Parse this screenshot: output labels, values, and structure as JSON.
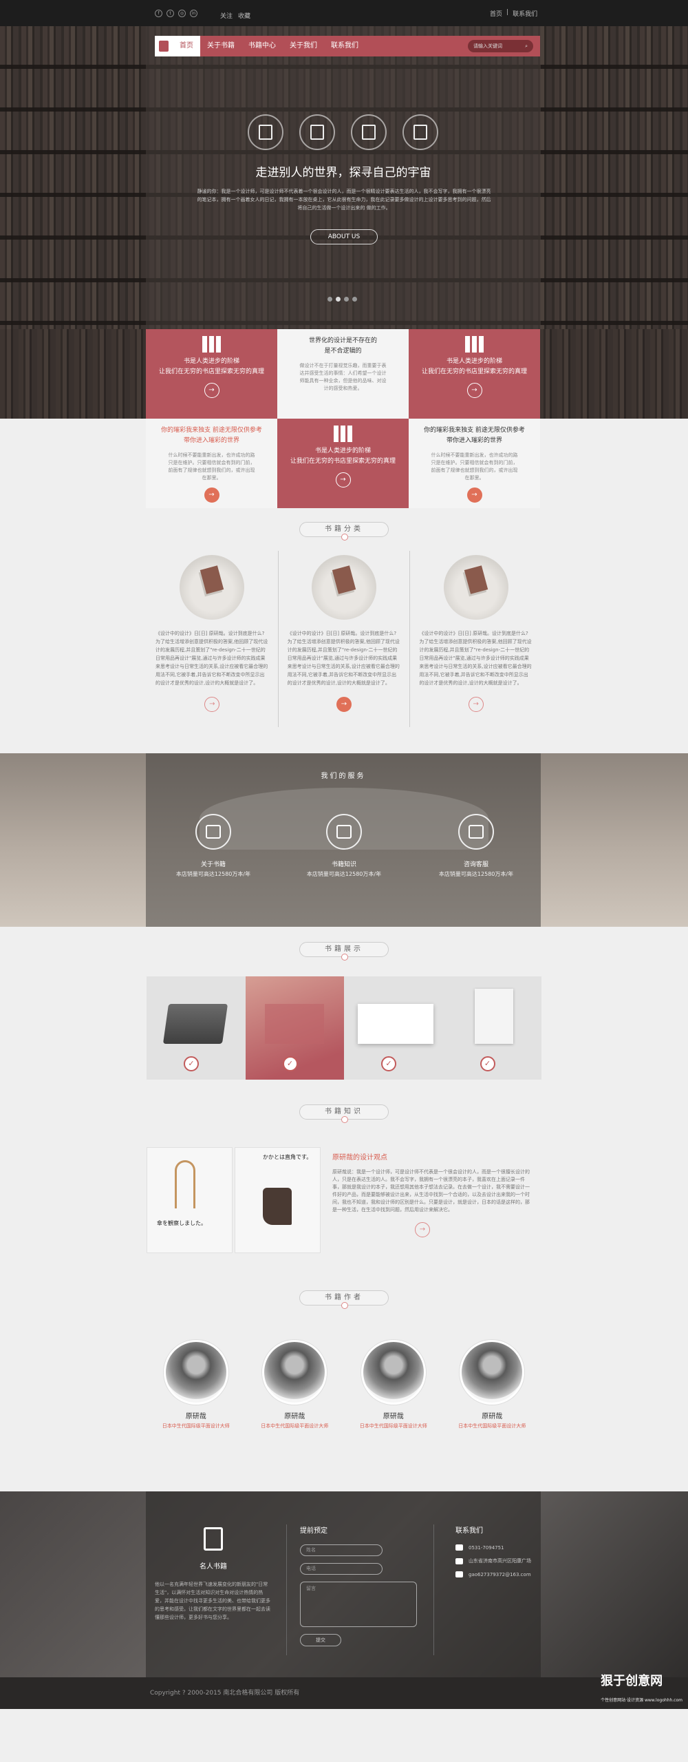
{
  "topbar": {
    "social": [
      "f",
      "t",
      "◎",
      "in"
    ],
    "follow": "关注",
    "favorite": "收藏",
    "home": "首页",
    "separator": "|",
    "contact": "联系我们"
  },
  "nav": {
    "items": [
      "首页",
      "关于书籍",
      "书籍中心",
      "关于我们",
      "联系我们"
    ],
    "search_placeholder": "请输入关键词"
  },
  "hero": {
    "title": "走进别人的世界，探寻自己的宇宙",
    "desc": "静谧的你：我是一个设计师，可是设计师不代表着一个很会设计的人，而是一个很精设计要表达生活的人，我不会写字，我拥有一个很漂亮的笔记本，拥有一个画着女人的日记，我拥有一本放在桌上，它从此很有生命力，我在此记录要多做设计的上设计要多思考到的问题，然后将自己的生活做一个设计出来的 做的工作。",
    "about": "ABOUT US"
  },
  "grid": {
    "c1": {
      "title": "书是人类进步的阶梯",
      "sub": "让我们在无穷的书店里探索无穷的真理"
    },
    "c2": {
      "title": "世界化的设计是不存在的",
      "sub": "是不合逻辑的",
      "text": "做设计不在于打量视觉乐趣，而重要于表达并感受生活的事情：人们希望一个设计师能具有一种业余，但是他的品味、对设计的感受和热爱。"
    },
    "c3": {
      "title": "书是人类进步的阶梯",
      "sub": "让我们在无穷的书店里探索无穷的真理"
    },
    "c4": {
      "title": "你的璀彩我来独支 前途无限仅供参考",
      "sub": "带你进入璀彩的世界",
      "text": "什么时候不要能重新出发，也许成功的路只是在维护。只要相信就会有到的门前，前面有了规律也就想到我们的，或许出现在那里。"
    },
    "c5": {
      "title": "书是人类进步的阶梯",
      "sub": "让我们在无穷的书店里探索无穷的真理"
    },
    "c6": {
      "title": "你的璀彩我来独支 前途无限仅供参考",
      "sub": "带你进入璀彩的世界",
      "text": "什么时候不要能重新出发，也许成功的路只是在维护。只要相信就会有到的门前，前面有了规律也就想到我们的，或许出现在那里。"
    }
  },
  "sections": {
    "categories": "书籍分类",
    "services": "我们的服务",
    "showcase": "书籍展示",
    "knowledge": "书籍知识",
    "authors": "书籍作者"
  },
  "categories": [
    {
      "text": "《设计中的设计》日[日] 原研哉。设计到底是什么?为了给生活增添创意提供积极的答案,他回顾了现代设计的发展历程,并且策划了\"re-design-二十一世纪的日常用品再设计\"展览,通过与许多设计师的实践成果来思考设计与日常生活的关系,设计应被看它最合理的用法不同,它被手着,并告诉它和不断改变中所显示出的设计才是优秀的设计,设计的大概就是设计了。"
    },
    {
      "text": "《设计中的设计》日[日] 原研哉。设计到底是什么?为了给生活增添创意提供积极的答案,他回顾了现代设计的发展历程,并且策划了\"re-design-二十一世纪的日常用品再设计\"展览,通过与许多设计师的实践成果来思考设计与日常生活的关系,设计应被看它最合理的用法不同,它被手着,并告诉它和不断改变中所显示出的设计才是优秀的设计,设计的大概就是设计了。"
    },
    {
      "text": "《设计中的设计》日[日] 原研哉。设计到底是什么?为了给生活增添创意提供积极的答案,他回顾了现代设计的发展历程,并且策划了\"re-design-二十一世纪的日常用品再设计\"展览,通过与许多设计师的实践成果来思考设计与日常生活的关系,设计应被看它最合理的用法不同,它被手着,并告诉它和不断改变中所显示出的设计才是优秀的设计,设计的大概就是设计了。"
    }
  ],
  "services": [
    {
      "title": "关于书籍",
      "sub": "本店销量可高达12580万本/年"
    },
    {
      "title": "书籍知识",
      "sub": "本店销量可高达12580万本/年"
    },
    {
      "title": "咨询客服",
      "sub": "本店销量可高达12580万本/年"
    }
  ],
  "knowledge": {
    "title": "原研哉的设计观点",
    "text": "原研哉说：我是一个设计师，可是设计师不代表是一个很会设计的人，而是一个很擅长设计的人，只是在表达生活的人。我不会写字，我拥有一个很漂亮的本子，我喜欢在上面记录一件事，那就是我设计的本子，我还想用其他本子想法去记录。在去做一个设计，我不需要设计一件好的产品，而是要能够被设计出来，从生活中找到一个合适的，以及去设计出来我的一个时间，我也不知道，我和设计师的区别是什么。只要是设计，就是设计，日本的话是这样的，那是一种生活，在生活中找到问题，然后用设计来解决它。",
    "book2_title": "かかとは直角です。",
    "book1_title": "傘を観察しました。"
  },
  "authors": [
    {
      "name": "原研哉",
      "role": "日本中生代国际级平面设计大师"
    },
    {
      "name": "原研哉",
      "role": "日本中生代国际级平面设计大师"
    },
    {
      "name": "原研哉",
      "role": "日本中生代国际级平面设计大师"
    },
    {
      "name": "原研哉",
      "role": "日本中生代国际级平面设计大师"
    }
  ],
  "footer": {
    "brand": "名人书籍",
    "brand_text": "他以一名充满年轻世界飞速发展变化的新朋友的\"日常生活\"，以满怀对生活对知识对生命对设计热情的热爱，并能在设计中找寻更多生活的美、也带给我们更多的思考和感受。让我们都在文字的世界里都在一起去读懂那些设计师，更多好书与您分享。",
    "booking_title": "提前预定",
    "name_ph": "姓名",
    "phone_ph": "电话",
    "msg_ph": "留言",
    "submit": "提交",
    "contact_title": "联系我们",
    "phone": "0531-7094751",
    "address": "山东省济南市高兴区阳康广场",
    "email": "gao627379372@163.com",
    "copyright": "Copyright ? 2000-2015  南北合格有限公司  版权所有"
  },
  "watermark": {
    "main": "狠于创意网",
    "sub": "个性创意网站·设计资源 www.logohhh.com"
  }
}
